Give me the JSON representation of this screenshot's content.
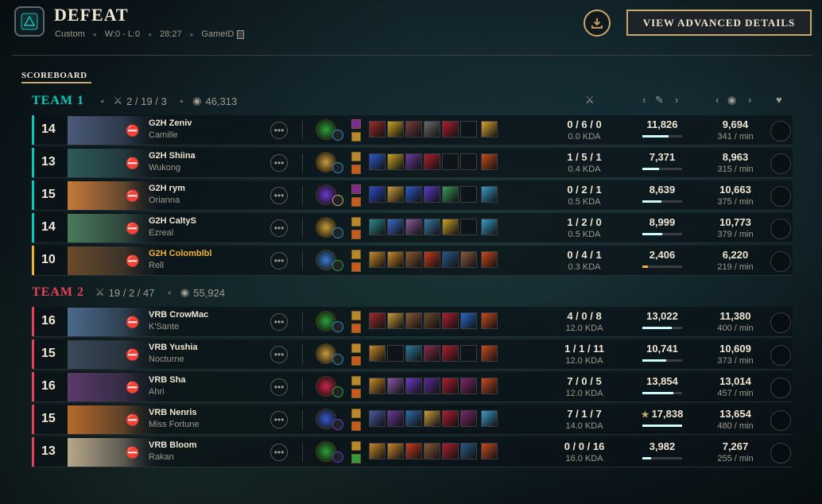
{
  "header": {
    "title": "DEFEAT",
    "mode": "Custom",
    "record": "W:0 - L:0",
    "duration": "28:27",
    "gameid_label": "GameID",
    "advanced_button": "VIEW ADVANCED DETAILS"
  },
  "tabs": {
    "scoreboard": "SCOREBOARD"
  },
  "colors": {
    "team1": "#0ac8b9",
    "team2": "#e84057",
    "gold": "#c8aa6e",
    "highlight_player": "#f0b232"
  },
  "team1": {
    "name": "TEAM 1",
    "kda": "2 / 19 / 3",
    "gold": "46,313",
    "players": [
      {
        "level": "14",
        "name": "G2H Zeniv",
        "champion": "Camille",
        "kda": "0 / 6 / 0",
        "ratio": "0.0 KDA",
        "damage": "11,826",
        "dmg_frac": 0.66,
        "gold": "9,694",
        "gpm": "341 / min",
        "keystone": "#2f9e3a",
        "secondary": "#2f8ab8",
        "portrait": "#4a5a78",
        "items": [
          "#a12a2a",
          "#c9a227",
          "#7a3b3b",
          "#6b6b6b",
          "#b01e2e",
          "#0e1418",
          "#d8a530"
        ],
        "spells": [
          "#7a2a9a",
          "#b8892a"
        ]
      },
      {
        "level": "13",
        "name": "G2H Shiina",
        "champion": "Wukong",
        "kda": "1 / 5 / 1",
        "ratio": "0.4 KDA",
        "damage": "7,371",
        "dmg_frac": 0.41,
        "gold": "8,963",
        "gpm": "315 / min",
        "keystone": "#c89b3c",
        "secondary": "#2f8ab8",
        "portrait": "#2e5a5a",
        "items": [
          "#2a5ac8",
          "#c9a227",
          "#6b3a9a",
          "#b01e2e",
          "#0e1418",
          "#0e1418",
          "#c84a1e"
        ],
        "spells": [
          "#b8892a",
          "#c85a1e"
        ]
      },
      {
        "level": "15",
        "name": "G2H rym",
        "champion": "Orianna",
        "kda": "0 / 2 / 1",
        "ratio": "0.5 KDA",
        "damage": "8,639",
        "dmg_frac": 0.48,
        "gold": "10,663",
        "gpm": "375 / min",
        "keystone": "#6a3ac8",
        "secondary": "#c8aa6e",
        "portrait": "#c87a3a",
        "items": [
          "#2a4ac8",
          "#c89b3c",
          "#2a5ac8",
          "#5a3ac8",
          "#3a9a5a",
          "#0e1418",
          "#3a9ac8"
        ],
        "spells": [
          "#7a2a9a",
          "#c85a1e"
        ]
      },
      {
        "level": "14",
        "name": "G2H CaltyS",
        "champion": "Ezreal",
        "kda": "1 / 2 / 0",
        "ratio": "0.5 KDA",
        "damage": "8,999",
        "dmg_frac": 0.5,
        "gold": "10,773",
        "gpm": "379 / min",
        "keystone": "#c89b3c",
        "secondary": "#2f8ab8",
        "portrait": "#4a7a5a",
        "items": [
          "#2a8a8a",
          "#3a6ac8",
          "#8a5a9a",
          "#3a7aa8",
          "#c9a227",
          "#0e1418",
          "#3a9ac8"
        ],
        "spells": [
          "#b8892a",
          "#c85a1e"
        ]
      },
      {
        "level": "10",
        "name": "G2H Colomblbl",
        "champion": "Rell",
        "kda": "0 / 4 / 1",
        "ratio": "0.3 KDA",
        "damage": "2,406",
        "dmg_frac": 0.13,
        "gold": "6,220",
        "gpm": "219 / min",
        "keystone": "#3a7ac8",
        "secondary": "#2f9e3a",
        "portrait": "#6a4a2a",
        "items": [
          "#c8882a",
          "#c8882a",
          "#8a5a2a",
          "#c83a1e",
          "#2a5a8a",
          "#8a5a3a",
          "#c84a1e"
        ],
        "spells": [
          "#b8892a",
          "#c85a1e"
        ],
        "highlight": true
      }
    ]
  },
  "team2": {
    "name": "TEAM 2",
    "kda": "19 / 2 / 47",
    "gold": "55,924",
    "players": [
      {
        "level": "16",
        "name": "VRB CrowMac",
        "champion": "K'Sante",
        "kda": "4 / 0 / 8",
        "ratio": "12.0 KDA",
        "damage": "13,022",
        "dmg_frac": 0.73,
        "gold": "11,380",
        "gpm": "400 / min",
        "keystone": "#2f9e3a",
        "secondary": "#2f8ab8",
        "portrait": "#4a6a8a",
        "items": [
          "#a12a2a",
          "#c89b3c",
          "#8a5a3a",
          "#6a4a2a",
          "#b01e2e",
          "#2a6ac8",
          "#c84a1e"
        ],
        "spells": [
          "#b8892a",
          "#c85a1e"
        ]
      },
      {
        "level": "15",
        "name": "VRB Yushia",
        "champion": "Nocturne",
        "kda": "1 / 1 / 11",
        "ratio": "12.0 KDA",
        "damage": "10,741",
        "dmg_frac": 0.6,
        "gold": "10,609",
        "gpm": "373 / min",
        "keystone": "#c89b3c",
        "secondary": "#2f8ab8",
        "portrait": "#3a4a5a",
        "items": [
          "#c8882a",
          "#0e1418",
          "#2a7a9a",
          "#8a2a4a",
          "#b01e2e",
          "#0e1418",
          "#c84a1e"
        ],
        "spells": [
          "#b8892a",
          "#c85a1e"
        ]
      },
      {
        "level": "16",
        "name": "VRB Sha",
        "champion": "Ahri",
        "kda": "7 / 0 / 5",
        "ratio": "12.0 KDA",
        "damage": "13,854",
        "dmg_frac": 0.78,
        "gold": "13,014",
        "gpm": "457 / min",
        "keystone": "#c8284a",
        "secondary": "#2f9e3a",
        "portrait": "#5a3a6a",
        "items": [
          "#c8882a",
          "#8a5aa8",
          "#6a3ac8",
          "#5a2a9a",
          "#b01e2e",
          "#7a2a6a",
          "#c84a1e"
        ],
        "spells": [
          "#b8892a",
          "#c85a1e"
        ]
      },
      {
        "level": "15",
        "name": "VRB Nenris",
        "champion": "Miss Fortune",
        "kda": "7 / 1 / 7",
        "ratio": "14.0 KDA",
        "damage": "17,838",
        "dmg_frac": 1.0,
        "gold": "13,654",
        "gpm": "480 / min",
        "keystone": "#3a5ac8",
        "secondary": "#6a3ac8",
        "portrait": "#b86a2a",
        "items": [
          "#4a5aa8",
          "#6a3a9a",
          "#2a6aa8",
          "#c89b3c",
          "#b01e2e",
          "#7a2a6a",
          "#3a9ac8"
        ],
        "spells": [
          "#b8892a",
          "#c85a1e"
        ],
        "mvp": true
      },
      {
        "level": "13",
        "name": "VRB Bloom",
        "champion": "Rakan",
        "kda": "0 / 0 / 16",
        "ratio": "16.0 KDA",
        "damage": "3,982",
        "dmg_frac": 0.22,
        "gold": "7,267",
        "gpm": "255 / min",
        "keystone": "#2f9e3a",
        "secondary": "#6a3ac8",
        "portrait": "#b8a88a",
        "items": [
          "#c8882a",
          "#c8882a",
          "#c83a1e",
          "#8a5a3a",
          "#b01e2e",
          "#2a5a8a",
          "#c84a1e"
        ],
        "spells": [
          "#b8892a",
          "#2f9e3a"
        ]
      }
    ]
  }
}
